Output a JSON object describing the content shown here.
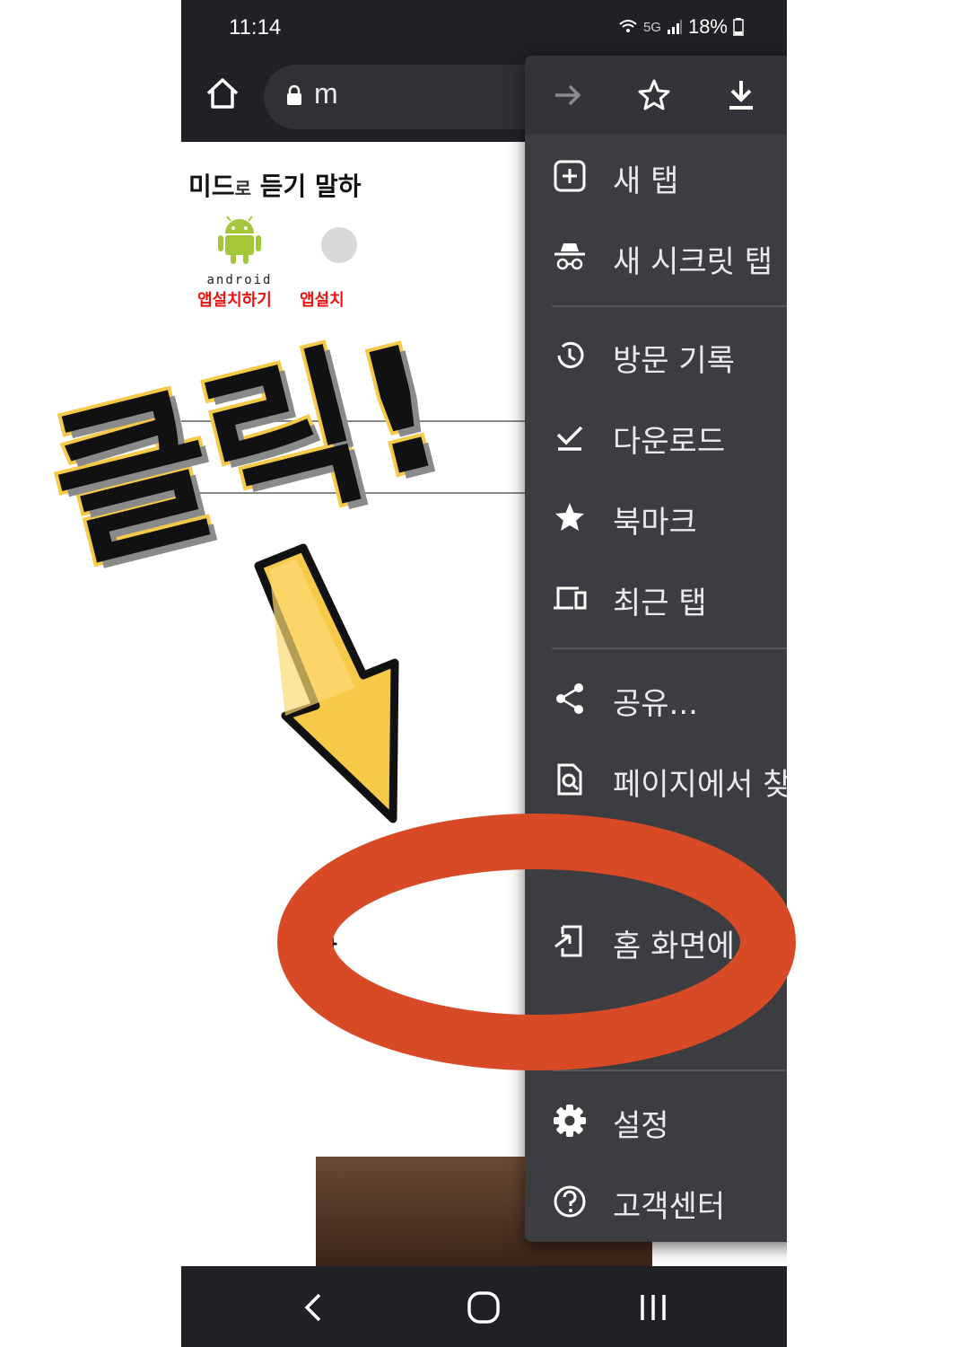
{
  "status_bar": {
    "time": "11:14",
    "network": "5G",
    "battery": "18%"
  },
  "toolbar": {
    "url_text": "m"
  },
  "web_page": {
    "title_part1": "미드",
    "title_small": "로",
    "title_part2": " 듣기 말하",
    "android_word": "android",
    "install_android": "앱설치하기",
    "install_ios": "앱설치",
    "text_a": "말",
    "text_b": "미"
  },
  "menu": {
    "icon_bar": [
      "forward-icon",
      "star-icon",
      "download-icon",
      "info-icon",
      "refresh-icon"
    ],
    "items": [
      {
        "label": "새 탭",
        "icon": "new-tab-icon"
      },
      {
        "label": "새 시크릿 탭",
        "icon": "incognito-icon"
      },
      {
        "label": "방문 기록",
        "icon": "history-icon"
      },
      {
        "label": "다운로드",
        "icon": "download-done-icon"
      },
      {
        "label": "북마크",
        "icon": "bookmark-star-icon"
      },
      {
        "label": "최근 탭",
        "icon": "recent-tabs-icon"
      },
      {
        "label": "공유...",
        "icon": "share-icon"
      },
      {
        "label": "페이지에서 찾기",
        "icon": "find-in-page-icon"
      },
      {
        "label": "...",
        "icon": ""
      },
      {
        "label": "홈 화면에 추가",
        "icon": "add-to-home-icon"
      },
      {
        "label": "",
        "icon": ""
      },
      {
        "label": "설정",
        "icon": "settings-icon"
      },
      {
        "label": "고객센터",
        "icon": "help-icon"
      }
    ]
  },
  "annotation": {
    "click_text": "클릭!",
    "arrow_color": "#f7c948",
    "ellipse_color": "#d84a25"
  },
  "colors": {
    "chrome_dark": "#202124",
    "menu_bg": "#3c3d40",
    "menu_text": "#e8eaed",
    "install_red": "#ee1111",
    "android_green": "#a4c639"
  }
}
